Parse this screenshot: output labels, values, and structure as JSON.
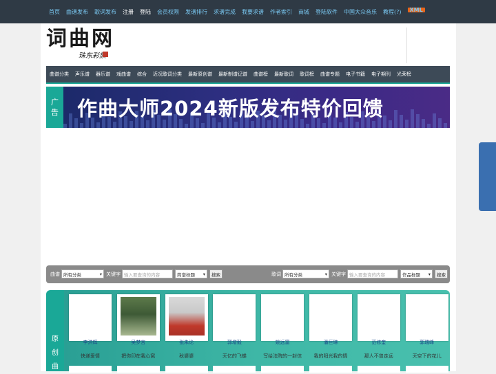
{
  "topnav": {
    "items": [
      {
        "label": "首页",
        "white": false
      },
      {
        "label": "曲谱发布",
        "white": false
      },
      {
        "label": "歌词发布",
        "white": false
      },
      {
        "label": "注册",
        "white": true
      },
      {
        "label": "登陆",
        "white": true
      },
      {
        "label": "会员权限",
        "white": false
      },
      {
        "label": "发谱排行",
        "white": false
      },
      {
        "label": "求谱完成",
        "white": false
      },
      {
        "label": "我要求谱",
        "white": false
      },
      {
        "label": "作者索引",
        "white": false
      },
      {
        "label": "商城",
        "white": false
      },
      {
        "label": "登陆软件",
        "white": false
      },
      {
        "label": "中国大众音乐",
        "white": false
      },
      {
        "label": "教程(?)",
        "white": false
      }
    ],
    "xml_badge": "XML"
  },
  "logo": {
    "main": "词曲网",
    "sub": "珠东彩旗"
  },
  "categories": [
    "曲谱分类",
    "声乐谱",
    "器乐谱",
    "戏曲谱",
    "综合",
    "近况歌词分类",
    "最新原创谱",
    "最新制谱记谱",
    "曲谱榜",
    "最新歌词",
    "歌词榜",
    "曲谱专题",
    "电子书籍",
    "电子期刊",
    "光荣榜"
  ],
  "banner": {
    "side": [
      "广",
      "告"
    ],
    "text": "作曲大师2024新版发布特价回馈"
  },
  "search_score": {
    "label": "曲谱",
    "category": "所有分类",
    "keyword_label": "关键字",
    "placeholder": "输入要查询的内容",
    "field": "简谱标题",
    "button": "搜索"
  },
  "search_lyrics": {
    "label": "歌词",
    "category": "所有分类",
    "keyword_label": "关键字",
    "placeholder": "输入要查询的内容",
    "field": "作品标题",
    "button": "搜索"
  },
  "original": {
    "side": [
      "原",
      "创",
      "曲"
    ],
    "cards": [
      {
        "name": "李洪辉",
        "song": "快递爱情",
        "photo": false
      },
      {
        "name": "吴梦言",
        "song": "把你印在我心窝",
        "photo": true
      },
      {
        "name": "张朱论",
        "song": "秋婆婆",
        "photo": true
      },
      {
        "name": "郭增毅",
        "song": "天亿的飞蝶",
        "photo": false
      },
      {
        "name": "姚远富",
        "song": "写给法院的一封信",
        "photo": false
      },
      {
        "name": "潘巨琳",
        "song": "我的阳光我的情",
        "photo": false
      },
      {
        "name": "范修奎",
        "song": "那人不曾走远",
        "photo": false
      },
      {
        "name": "郭瑞峰",
        "song": "天空下的花儿",
        "photo": false
      }
    ]
  },
  "colors": {
    "topbar": "#2f3a45",
    "nav_link": "#79c7f0",
    "teal": "#1aa897",
    "catbar": "#3d4a57"
  }
}
